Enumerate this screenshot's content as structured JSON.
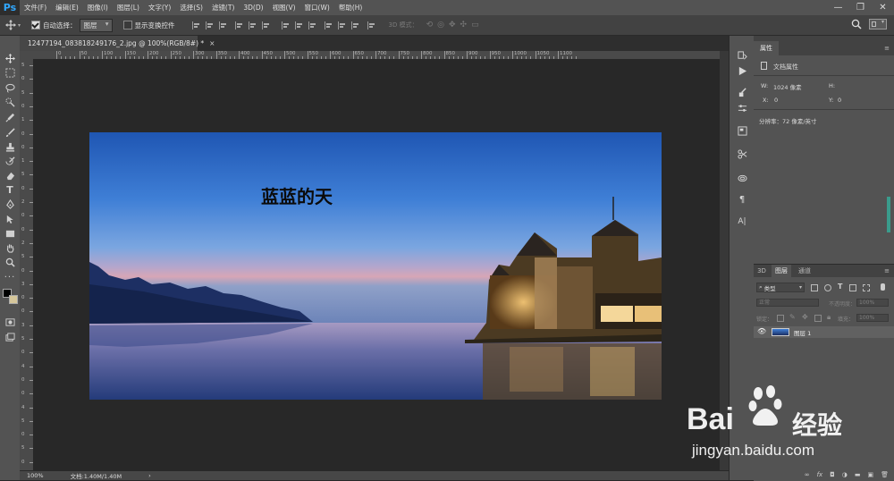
{
  "app": {
    "logo": "Ps"
  },
  "menu": [
    "文件(F)",
    "编辑(E)",
    "图像(I)",
    "图层(L)",
    "文字(Y)",
    "选择(S)",
    "滤镜(T)",
    "3D(D)",
    "视图(V)",
    "窗口(W)",
    "帮助(H)"
  ],
  "window_controls": {
    "minimize": "—",
    "restore": "❐",
    "close": "✕"
  },
  "options": {
    "auto_select_label": "自动选择：",
    "auto_select_value": "图层",
    "show_transform_label": "显示变换控件",
    "mode_3d_label": "3D 模式："
  },
  "document": {
    "tab_title": "12477194_083818249176_2.jpg @ 100%(RGB/8#) *",
    "tab_close": "×",
    "text_layer": "蓝蓝的天"
  },
  "ruler_top_labels": [
    "0",
    "50",
    "100",
    "150",
    "200",
    "250",
    "300",
    "350",
    "400",
    "450",
    "500",
    "550",
    "600",
    "650",
    "700",
    "750",
    "800",
    "850",
    "900",
    "950",
    "1000",
    "1050",
    "1100"
  ],
  "ruler_left_labels": [
    "5",
    "0",
    "5",
    "0",
    "1",
    "0",
    "0",
    "1",
    "5",
    "0",
    "2",
    "0",
    "0",
    "2",
    "5",
    "0",
    "3",
    "0",
    "0",
    "3",
    "5",
    "0",
    "4",
    "0",
    "0",
    "4",
    "5",
    "0",
    "5",
    "0"
  ],
  "status": {
    "zoom": "100%",
    "doc": "文档:1.40M/1.40M",
    "arrow": "›"
  },
  "properties": {
    "tab": "属性",
    "heading": "文档属性",
    "w_label": "W:",
    "w_value": "1024 像素",
    "h_label": "H:",
    "h_value": "",
    "x_label": "X:",
    "x_value": "0",
    "y_label": "Y:",
    "y_value": "0",
    "resolution": "分辨率：72 像素/英寸"
  },
  "layers": {
    "tabs": [
      "3D",
      "图层",
      "通道"
    ],
    "filter_kind": "类型",
    "blend_mode": "正常",
    "opacity_label": "不透明度：",
    "opacity_value": "100%",
    "lock_label": "锁定：",
    "fill_label": "填充：",
    "fill_value": "100%",
    "layer_name": "图层 1",
    "footer_icons": [
      "link",
      "fx",
      "mask",
      "adjust",
      "group",
      "new",
      "trash"
    ]
  },
  "watermark": {
    "brand": "Bai",
    "brand2": "经验",
    "url": "jingyan.baidu.com"
  },
  "colors": {
    "accent": "#31a8ff",
    "panel": "#535353",
    "canvas": "#282828"
  }
}
